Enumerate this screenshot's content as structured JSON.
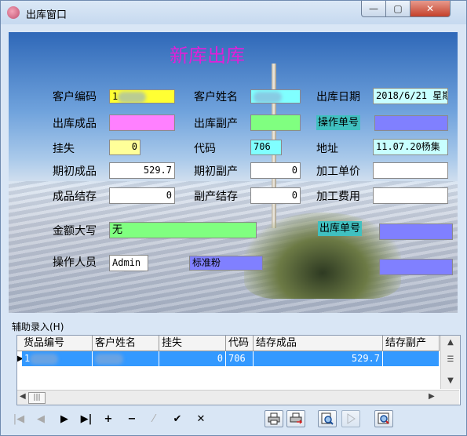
{
  "window": {
    "title": "出库窗口",
    "controls": {
      "minimize": "—",
      "maximize": "▢",
      "close": "✕"
    }
  },
  "form": {
    "heading": "新库出库",
    "labels": {
      "customer_code": "客户编码",
      "customer_name": "客户姓名",
      "date": "出库日期",
      "finished_goods": "出库成品",
      "byproduct": "出库副产",
      "op_no": "操作单号",
      "on_account": "挂失",
      "code": "代码",
      "address": "地址",
      "opening_goods": "期初成品",
      "opening_byproduct": "期初副产",
      "process_price": "加工单价",
      "goods_stock": "成品结存",
      "byproduct_stock": "副产结存",
      "process_fee": "加工费用",
      "amount_words": "金额大写",
      "out_no": "出库单号",
      "operator": "操作人员"
    },
    "values": {
      "customer_code": "1",
      "customer_name": "",
      "date": "2018/6/21 星期",
      "finished_goods": "",
      "byproduct": "",
      "op_no": "",
      "on_account": "0",
      "code": "706",
      "address": "11.07.20杨集",
      "opening_goods": "529.7",
      "opening_byproduct": "0",
      "process_price": "",
      "goods_stock": "0",
      "byproduct_stock": "0",
      "process_fee": "",
      "amount_words": "无",
      "out_no": "",
      "operator": "Admin",
      "standard_flour": "标准粉",
      "extra": ""
    }
  },
  "grid": {
    "title": "辅助录入(H)",
    "columns": [
      "货品编号",
      "客户姓名",
      "挂失",
      "代码",
      "结存成品",
      "结存副产"
    ],
    "rows": [
      {
        "goods_no": "1",
        "customer_name": "",
        "on_account": "0",
        "code": "706",
        "stock_goods": "529.7",
        "stock_byproduct": ""
      }
    ]
  },
  "toolbar": {
    "nav": [
      "|◀",
      "◀",
      "▶",
      "▶|",
      "+",
      "−",
      "⁄",
      "✔",
      "✕"
    ]
  },
  "colors": {
    "heading": "#e020d8",
    "yellow": "#ffff33",
    "magenta": "#ff80ff",
    "green": "#80ff80",
    "cyan": "#80ffff",
    "teal": "#40c0c0",
    "violet": "#8080ff",
    "selection": "#3399ff"
  }
}
